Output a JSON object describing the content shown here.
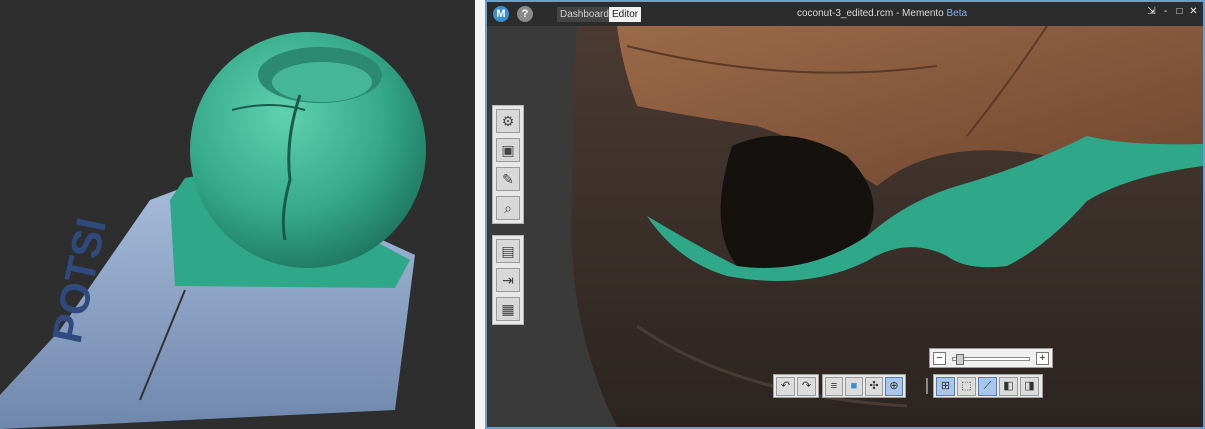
{
  "window": {
    "title": "coconut-3_edited.rcm - Memento",
    "title_suffix": "Beta",
    "logo": "M",
    "help": "?"
  },
  "tabs": [
    {
      "label": "Dashboard",
      "active": false
    },
    {
      "label": "Editor",
      "active": true
    }
  ],
  "window_controls": {
    "minimize": "-",
    "restore": "□",
    "close": "✕",
    "pin": "⇲"
  },
  "left_tools": {
    "group1": [
      "settings-wrench-icon",
      "cube-select-icon",
      "paint-brush-icon",
      "magnifier-inspect-icon"
    ],
    "group2": [
      "properties-panel-icon",
      "export-cube-icon",
      "layout-grid-icon"
    ]
  },
  "zoom": {
    "minus": "−",
    "plus": "+",
    "level": 0.05
  },
  "bottom_toolbar": {
    "undo": "↶",
    "redo": "↷",
    "list": "≡",
    "material": "■",
    "transform": "✣",
    "target": "⊕",
    "select_add": "⊞",
    "select_box": "⬚",
    "lasso": "⟋",
    "mirror": "◧",
    "view_side": "◨"
  },
  "colors": {
    "mesh_teal": "#2fa88a",
    "mesh_teal_light": "#4cc09e",
    "coconut_brown": "#8a5a3b",
    "paper_blue": "#8fa7c8",
    "accent_blue": "#6a9fd4"
  },
  "paper_text": "POTSI"
}
